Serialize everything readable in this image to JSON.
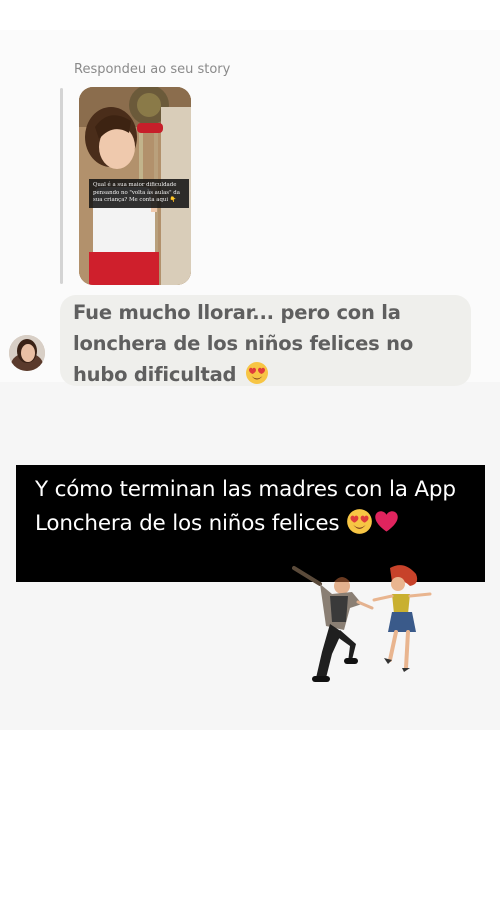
{
  "story_reply": {
    "label": "Respondeu ao seu story",
    "caption": "Qual é a sua maior dificuldade pensando no \"volta às aulas\" da sua criança? Me conta aqui 👇"
  },
  "message": {
    "text": "Fue mucho llorar... pero con la lonchera de los niños felices no hubo dificultad",
    "emoji": "heart-eyes-emoji"
  },
  "banner": {
    "text": "Y cómo terminan las madres con la App Lonchera de los niños felices",
    "emojis": [
      "heart-eyes-emoji",
      "red-heart-emoji"
    ]
  },
  "colors": {
    "bubble": "#efefec",
    "message_text": "#5f5f5f",
    "banner_bg": "#000000",
    "banner_text": "#ffffff",
    "heart": "#e0245e"
  }
}
